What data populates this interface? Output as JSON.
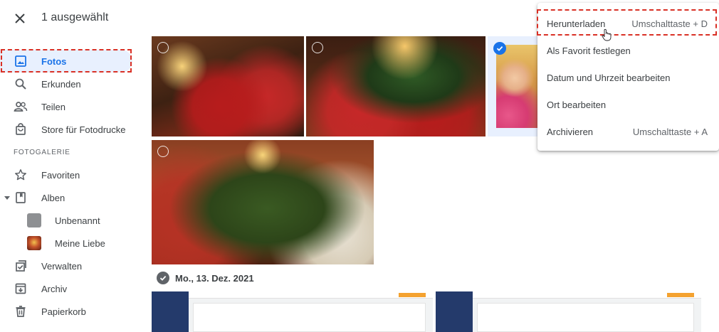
{
  "header": {
    "title": "1 ausgewählt",
    "close_icon": "close-icon"
  },
  "sidebar": {
    "items": [
      {
        "label": "Fotos",
        "icon": "photo-icon",
        "active": true
      },
      {
        "label": "Erkunden",
        "icon": "search-icon"
      },
      {
        "label": "Teilen",
        "icon": "people-icon"
      },
      {
        "label": "Store für Fotodrucke",
        "icon": "shopping-bag-icon"
      }
    ],
    "section_label": "FOTOGALERIE",
    "library": [
      {
        "label": "Favoriten",
        "icon": "star-icon"
      },
      {
        "label": "Alben",
        "icon": "album-icon",
        "expanded": true
      },
      {
        "label": "Unbenannt",
        "icon": "album-thumbnail-gray"
      },
      {
        "label": "Meine Liebe",
        "icon": "album-thumbnail-photo"
      },
      {
        "label": "Verwalten",
        "icon": "checklist-icon"
      },
      {
        "label": "Archiv",
        "icon": "archive-icon"
      },
      {
        "label": "Papierkorb",
        "icon": "trash-icon"
      }
    ]
  },
  "photos": {
    "date_header": "Mo., 13. Dez. 2021"
  },
  "menu": {
    "items": [
      {
        "label": "Herunterladen",
        "shortcut": "Umschalttaste + D",
        "highlighted": true
      },
      {
        "label": "Als Favorit festlegen",
        "shortcut": ""
      },
      {
        "label": "Datum und Uhrzeit bearbeiten",
        "shortcut": ""
      },
      {
        "label": "Ort bearbeiten",
        "shortcut": ""
      },
      {
        "label": "Archivieren",
        "shortcut": "Umschalttaste + A"
      }
    ]
  },
  "colors": {
    "accent": "#1a73e8",
    "active_bg": "#e8f0fe",
    "highlight_border": "#d93025"
  }
}
